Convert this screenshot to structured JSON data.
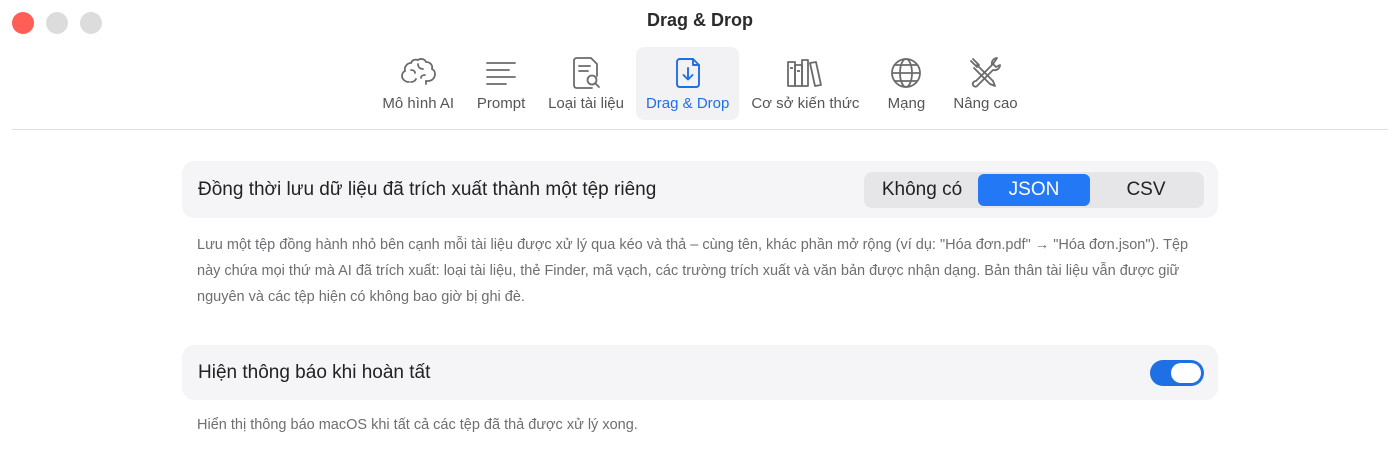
{
  "window": {
    "title": "Drag & Drop"
  },
  "toolbar": {
    "items": [
      {
        "label": "Mô hình AI",
        "icon": "brain-icon",
        "active": false
      },
      {
        "label": "Prompt",
        "icon": "text-lines-icon",
        "active": false
      },
      {
        "label": "Loại tài liệu",
        "icon": "document-search-icon",
        "active": false
      },
      {
        "label": "Drag & Drop",
        "icon": "document-download-icon",
        "active": true
      },
      {
        "label": "Cơ sở kiến thức",
        "icon": "books-icon",
        "active": false
      },
      {
        "label": "Mạng",
        "icon": "globe-icon",
        "active": false
      },
      {
        "label": "Nâng cao",
        "icon": "tools-icon",
        "active": false
      }
    ]
  },
  "settings": {
    "export": {
      "label": "Đồng thời lưu dữ liệu đã trích xuất thành một tệp riêng",
      "options": [
        "Không có",
        "JSON",
        "CSV"
      ],
      "selected": "JSON",
      "description": "Lưu một tệp đồng hành nhỏ bên cạnh mỗi tài liệu được xử lý qua kéo và thả – cùng tên, khác phần mở rộng (ví dụ: \"Hóa đơn.pdf\" → \"Hóa đơn.json\"). Tệp này chứa mọi thứ mà AI đã trích xuất: loại tài liệu, thẻ Finder, mã vạch, các trường trích xuất và văn bản được nhận dạng. Bản thân tài liệu vẫn được giữ nguyên và các tệp hiện có không bao giờ bị ghi đè."
    },
    "notify": {
      "label": "Hiện thông báo khi hoàn tất",
      "enabled": true,
      "description": "Hiển thị thông báo macOS khi tất cả các tệp đã thả được xử lý xong."
    }
  },
  "colors": {
    "accent": "#1f6fe5",
    "close": "#ff5f57"
  }
}
